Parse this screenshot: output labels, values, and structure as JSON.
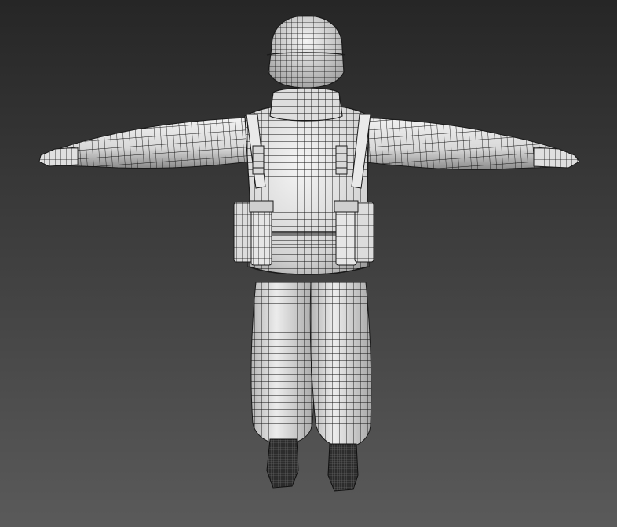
{
  "viewport": {
    "background_top": "#262626",
    "background_bottom": "#5a5a5a",
    "subject": "character-tpose-back-view",
    "render_mode": "shaded-with-wireframe"
  },
  "model": {
    "surface_light": "#f2f2f2",
    "surface_mid": "#cfcfcf",
    "surface_dark": "#8e8e8e",
    "wire_color": "#111111",
    "boot_color": "#2a2a2a"
  }
}
